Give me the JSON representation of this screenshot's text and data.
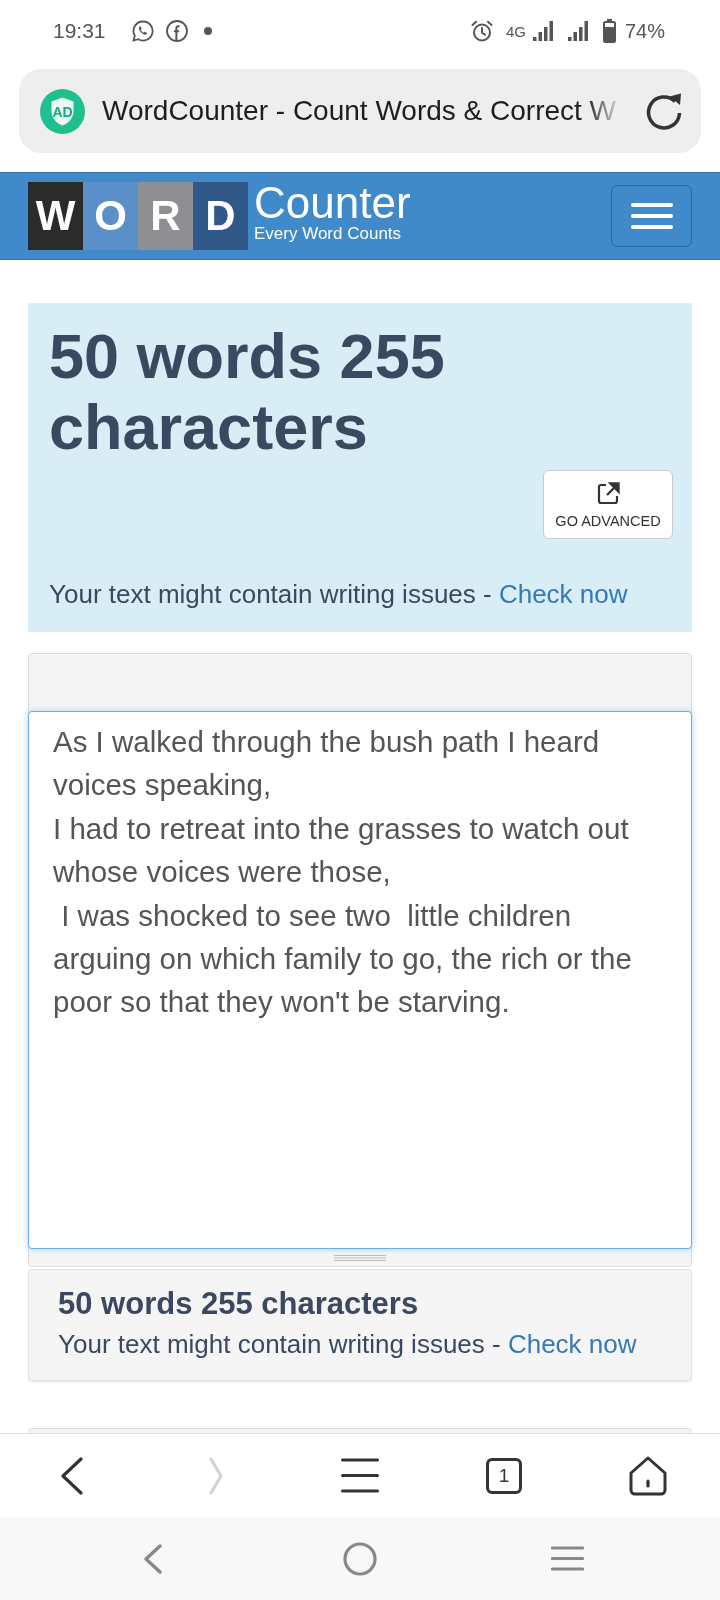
{
  "status_bar": {
    "time": "19:31",
    "network": "4G",
    "battery": "74%"
  },
  "browser_bar": {
    "badge": "AD",
    "title": "WordCounter - Count Words & Correct W"
  },
  "site_header": {
    "logo_tiles": [
      {
        "letter": "W",
        "color": "#2b2b2b"
      },
      {
        "letter": "O",
        "color": "#5a8fca"
      },
      {
        "letter": "R",
        "color": "#8e8f93"
      },
      {
        "letter": "D",
        "color": "#30598a"
      }
    ],
    "brand": "Counter",
    "tagline": "Every Word Counts"
  },
  "summary": {
    "heading": "50 words 255 characters",
    "advanced_button": "GO ADVANCED",
    "notice": "Your text might contain writing issues -",
    "notice_link": "Check now"
  },
  "editor": {
    "value": "As I walked through the bush path I heard voices speaking,\nI had to retreat into the grasses to watch out whose voices were those,\n I was shocked to see two  little children arguing on which family to go, the rich or the poor so that they won't be starving."
  },
  "stats": {
    "heading": "50 words 255 characters",
    "notice": "Your text might contain writing issues -",
    "notice_link": "Check now"
  },
  "browser_toolbar": {
    "forward_disabled": true,
    "tab_count": "1"
  }
}
